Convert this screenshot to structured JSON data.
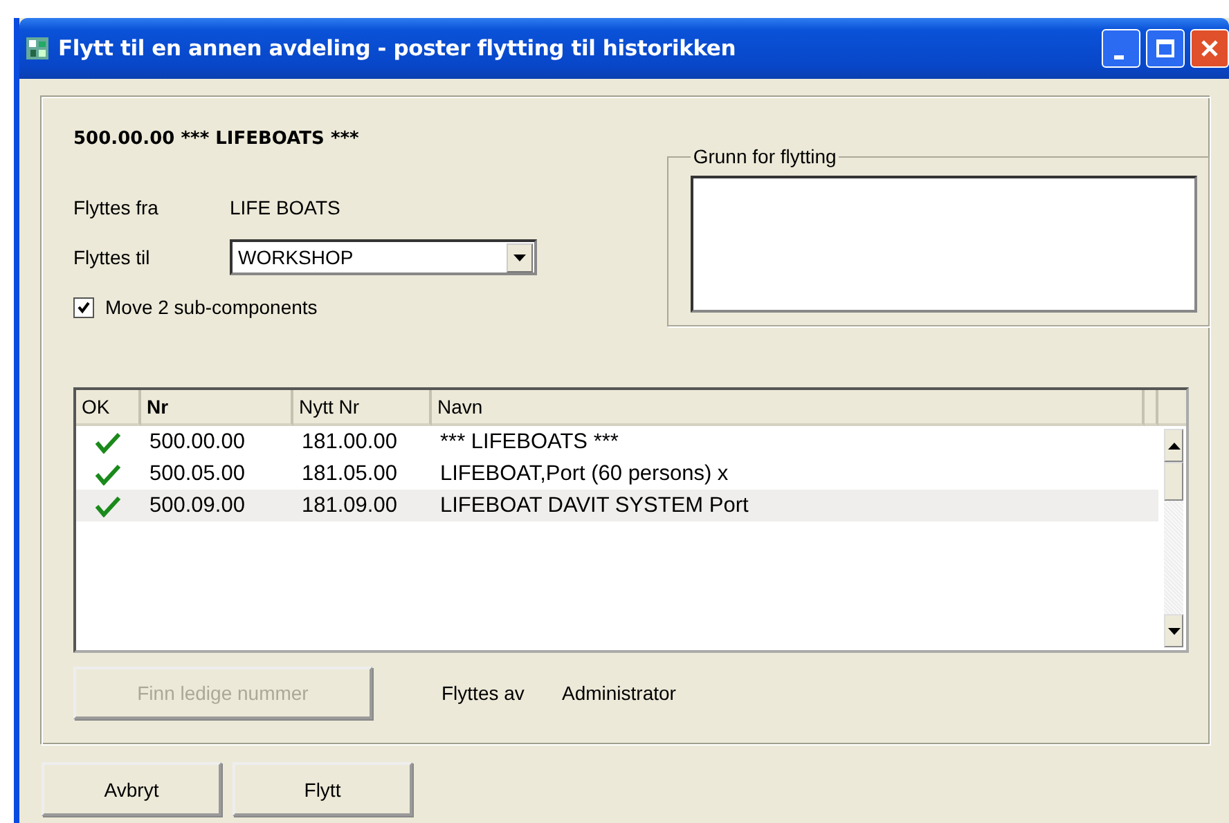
{
  "window": {
    "title": "Flytt til en annen avdeling - poster flytting til historikken"
  },
  "heading": "500.00.00 *** LIFEBOATS ***",
  "from": {
    "label": "Flyttes fra",
    "value": "LIFE BOATS"
  },
  "to": {
    "label": "Flyttes til",
    "value": "WORKSHOP"
  },
  "move_sub": {
    "label": "Move 2 sub-components",
    "checked": true
  },
  "reason": {
    "label": "Grunn for flytting"
  },
  "table": {
    "columns": [
      {
        "label": "OK",
        "bold": false
      },
      {
        "label": "Nr",
        "bold": true
      },
      {
        "label": "Nytt Nr",
        "bold": false
      },
      {
        "label": "Navn",
        "bold": false
      }
    ],
    "rows": [
      {
        "ok": true,
        "nr": "500.00.00",
        "new_nr": "181.00.00",
        "name": "*** LIFEBOATS ***",
        "selected": false
      },
      {
        "ok": true,
        "nr": "500.05.00",
        "new_nr": "181.05.00",
        "name": "LIFEBOAT,Port (60 persons) x",
        "selected": false
      },
      {
        "ok": true,
        "nr": "500.09.00",
        "new_nr": "181.09.00",
        "name": "LIFEBOAT DAVIT SYSTEM Port",
        "selected": true
      }
    ]
  },
  "find_button": {
    "label": "Finn ledige nummer",
    "disabled": true
  },
  "moved_by": {
    "label": "Flyttes av",
    "value": "Administrator"
  },
  "buttons": [
    "Avbryt",
    "Flytt"
  ]
}
